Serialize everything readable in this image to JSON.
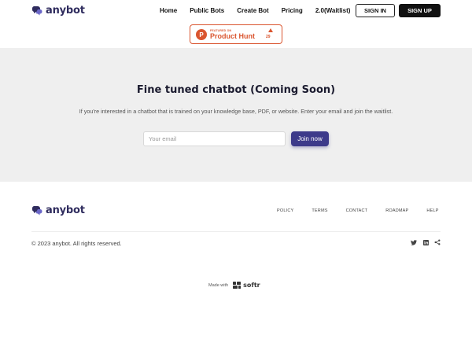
{
  "header": {
    "brand": "anybot",
    "nav": [
      "Home",
      "Public Bots",
      "Create Bot",
      "Pricing",
      "2.0(Waitlist)"
    ],
    "sign_in": "SIGN IN",
    "sign_up": "SIGN UP"
  },
  "product_hunt": {
    "featured_label": "FEATURED ON",
    "name": "Product Hunt",
    "upvotes": "29"
  },
  "hero": {
    "title": "Fine tuned chatbot (Coming Soon)",
    "subtitle": "If you're interested in a chatbot that is trained on your knowledge base, PDF, or website. Enter your email and join the waitlist.",
    "email_placeholder": "Your email",
    "email_value": "",
    "join_label": "Join now"
  },
  "footer": {
    "brand": "anybot",
    "links": [
      "POLICY",
      "TERMS",
      "CONTACT",
      "ROADMAP",
      "HELP"
    ],
    "copyright": "© 2023 anybot. All rights reserved.",
    "socials": [
      "twitter-icon",
      "linkedin-icon",
      "share-icon"
    ],
    "made_with": "Made with",
    "softr": "softr"
  },
  "colors": {
    "brand": "#2f2c5e",
    "accent": "#3d3a8a",
    "product_hunt": "#da552f",
    "hero_bg": "#efefef"
  }
}
